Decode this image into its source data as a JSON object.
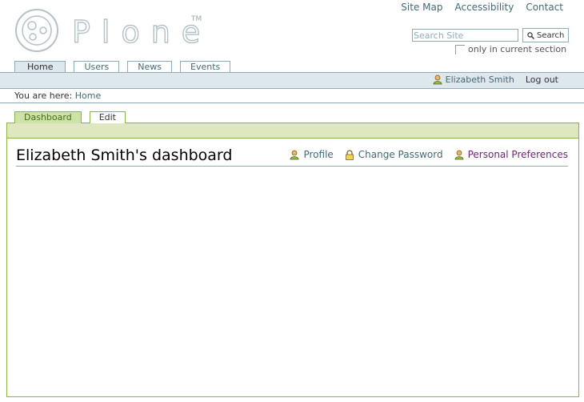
{
  "logo": {
    "wordmark": "Plone",
    "tm": "TM"
  },
  "site_actions": [
    "Site Map",
    "Accessibility",
    "Contact"
  ],
  "search": {
    "placeholder": "Search Site",
    "button": "Search",
    "only_current": "only in current section"
  },
  "portal_tabs": [
    {
      "label": "Home",
      "selected": true
    },
    {
      "label": "Users",
      "selected": false
    },
    {
      "label": "News",
      "selected": false
    },
    {
      "label": "Events",
      "selected": false
    }
  ],
  "personal_bar": {
    "user": "Elizabeth Smith",
    "logout": "Log out"
  },
  "breadcrumbs": {
    "prefix": "You are here:",
    "home": "Home"
  },
  "content_tabs": [
    {
      "label": "Dashboard",
      "selected": true
    },
    {
      "label": "Edit",
      "selected": false
    }
  ],
  "dashboard": {
    "title": "Elizabeth Smith's dashboard",
    "actions": {
      "profile": "Profile",
      "change_password": "Change Password",
      "preferences": "Personal Preferences"
    }
  },
  "colors": {
    "link": "#436976",
    "visited": "#6c2870",
    "tab_border": "#8cacbb",
    "green_border": "#8cb347",
    "green_band": "#dee7c0"
  }
}
